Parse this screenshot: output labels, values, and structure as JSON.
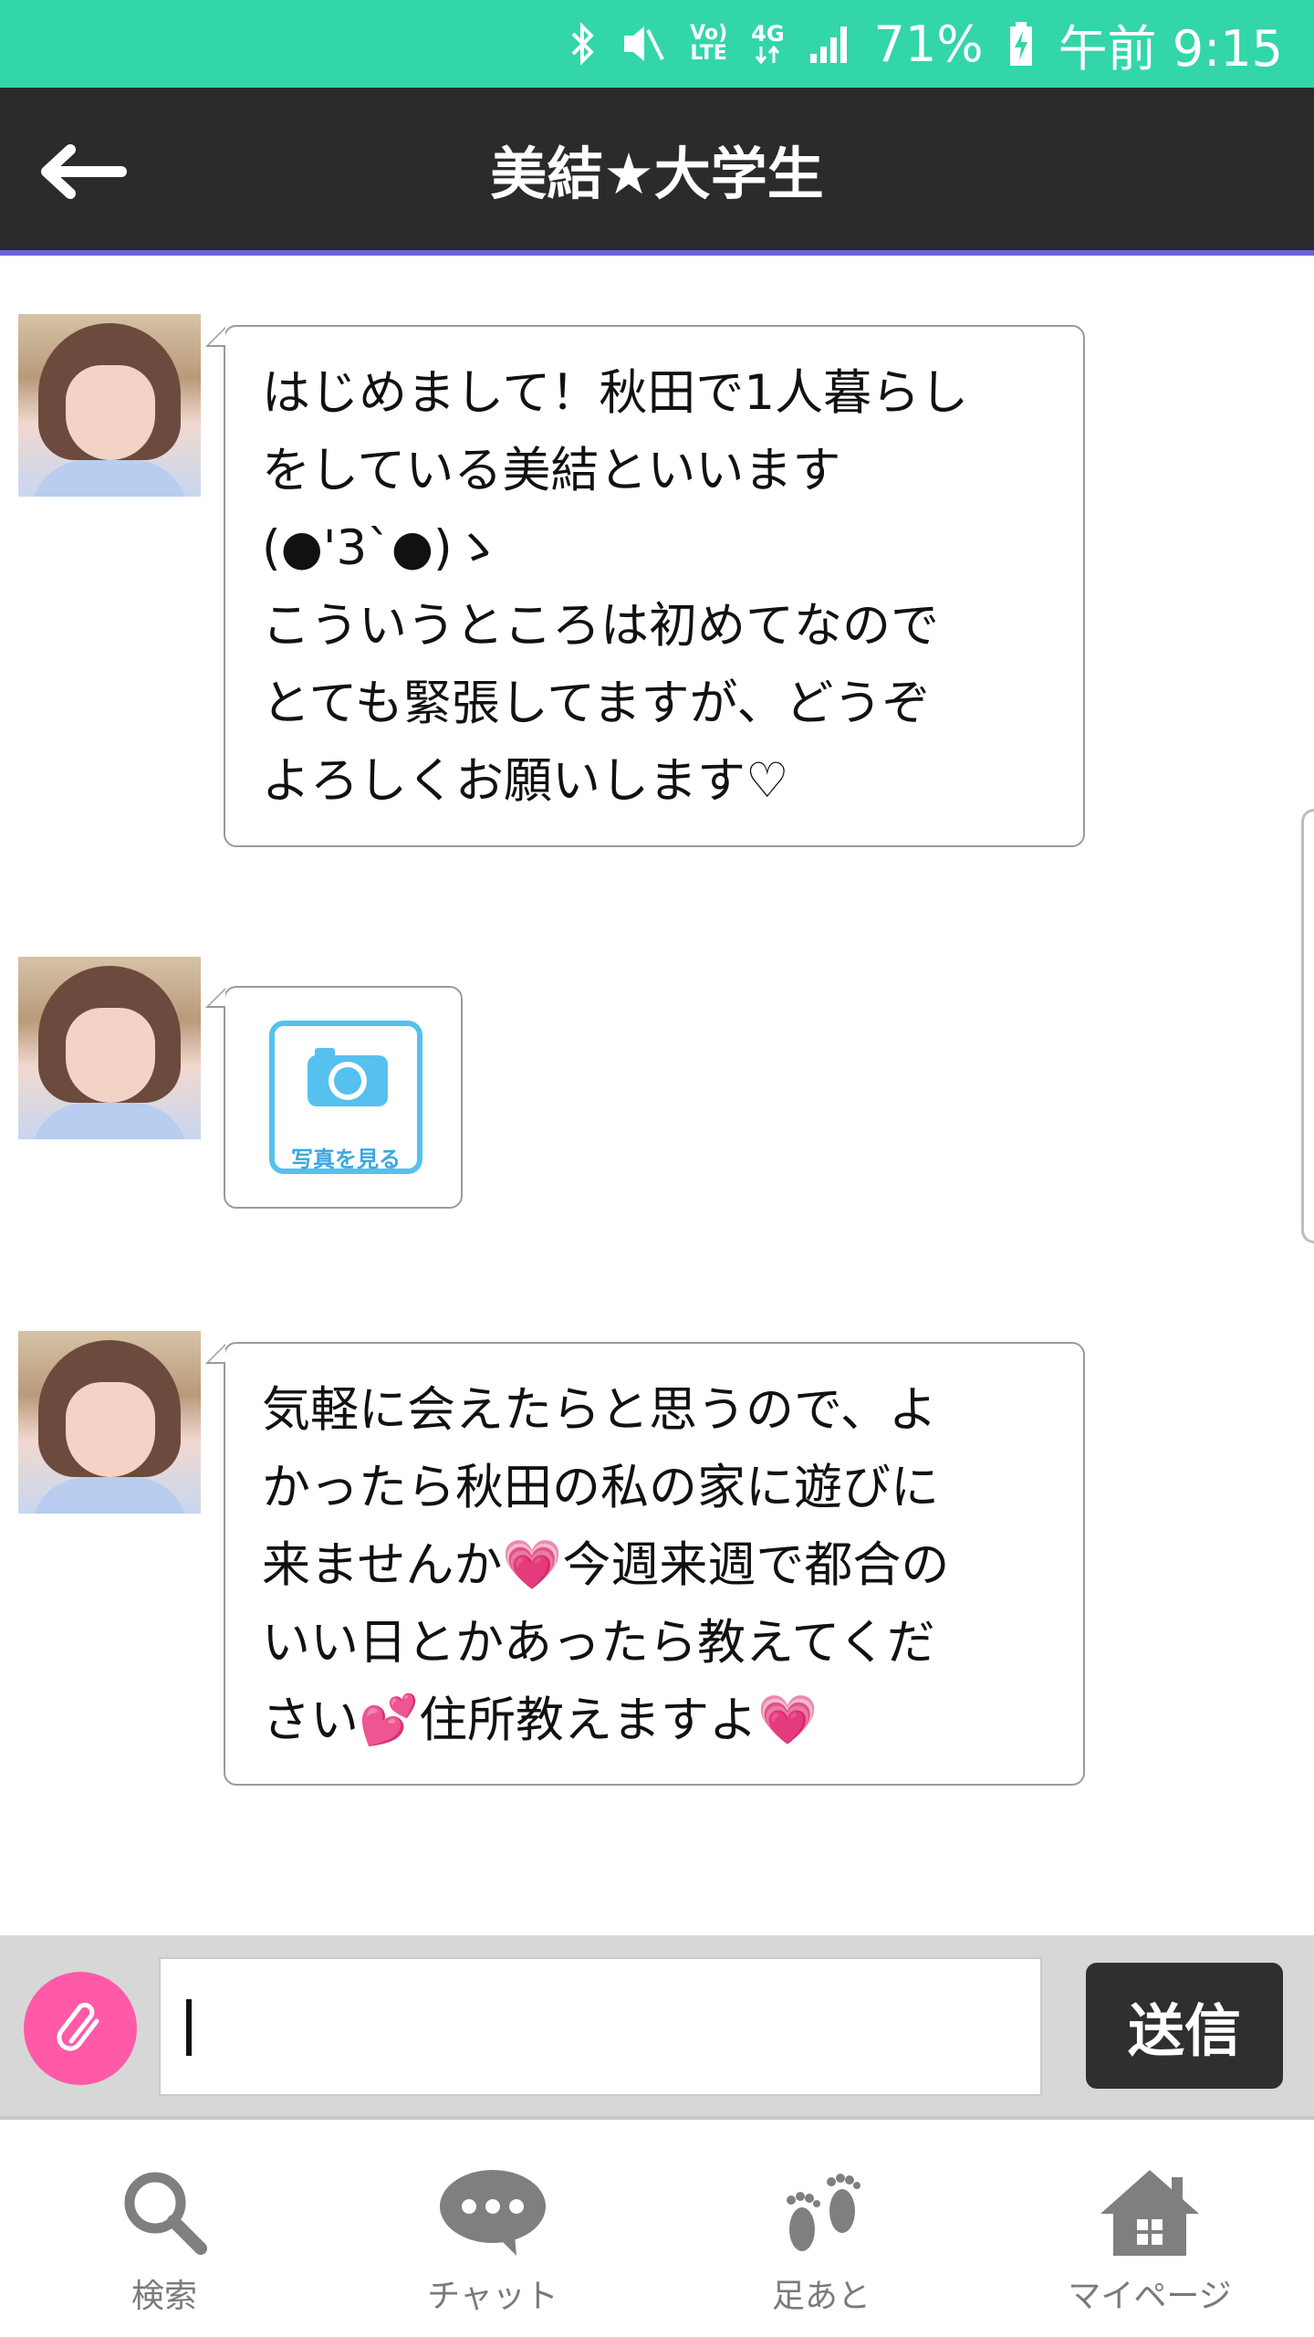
{
  "status_bar": {
    "network_small": "Vo)\nLTE",
    "network_4g": "4G",
    "battery": "71%",
    "time": "午前 9:15"
  },
  "header": {
    "title": "美結★大学生"
  },
  "messages": [
    {
      "type": "text",
      "text": "はじめまして！秋田で1人暮らし\nをしている美結といいます\n(●'3`●)ゝ\nこういうところは初めてなので\nとても緊張してますが、どうぞ\nよろしくお願いします♡"
    },
    {
      "type": "photo",
      "caption": "写真を見る"
    },
    {
      "type": "text",
      "text": "気軽に会えたらと思うので、よ\nかったら秋田の私の家に遊びに\n来ませんか💗今週来週で都合の\nいい日とかあったら教えてくだ\nさい💕住所教えますよ💗"
    }
  ],
  "input_bar": {
    "send_label": "送信"
  },
  "bottom_nav": [
    {
      "label": "検索",
      "icon": "search-icon"
    },
    {
      "label": "チャット",
      "icon": "chat-icon"
    },
    {
      "label": "足あと",
      "icon": "footprints-icon"
    },
    {
      "label": "マイページ",
      "icon": "home-icon"
    }
  ],
  "colors": {
    "status_bar": "#33d6a8",
    "header": "#2b2b2b",
    "header_accent": "#6c63d8",
    "attach": "#ff5aa7",
    "send": "#2f2f2f",
    "photo_card": "#56c0ee"
  }
}
